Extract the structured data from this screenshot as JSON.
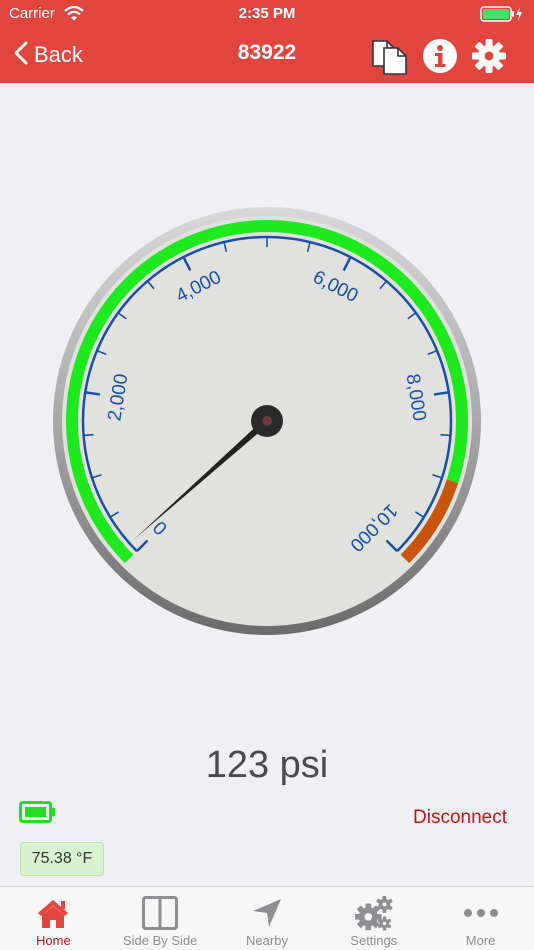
{
  "status_bar": {
    "carrier": "Carrier",
    "time": "2:35 PM"
  },
  "nav": {
    "back_label": "Back",
    "title": "83922",
    "icons": [
      "copy-icon",
      "info-icon",
      "gear-icon"
    ]
  },
  "gauge": {
    "unit": "psi",
    "min": 0,
    "max": 10000,
    "value": 123,
    "tick_labels": [
      "0",
      "2,000",
      "4,000",
      "6,000",
      "8,000",
      "10,000"
    ],
    "zones": [
      {
        "from": 0,
        "to": 9000,
        "color": "#1ee81e"
      },
      {
        "from": 9000,
        "to": 10000,
        "color": "#c9550c"
      }
    ],
    "label_color": "#1a4fa8"
  },
  "reading": "123 psi",
  "battery_status_icon": "battery-full-icon",
  "temperature": "75.38 °F",
  "disconnect_label": "Disconnect",
  "colors": {
    "accent": "#e0463e",
    "active_tab": "#c4161c",
    "inactive_tab": "#8e8e93"
  },
  "tabs": [
    {
      "label": "Home",
      "icon": "home-icon",
      "active": true
    },
    {
      "label": "Side By Side",
      "icon": "side-by-side-icon",
      "active": false
    },
    {
      "label": "Nearby",
      "icon": "location-arrow-icon",
      "active": false
    },
    {
      "label": "Settings",
      "icon": "gears-icon",
      "active": false
    },
    {
      "label": "More",
      "icon": "more-dots-icon",
      "active": false
    }
  ]
}
